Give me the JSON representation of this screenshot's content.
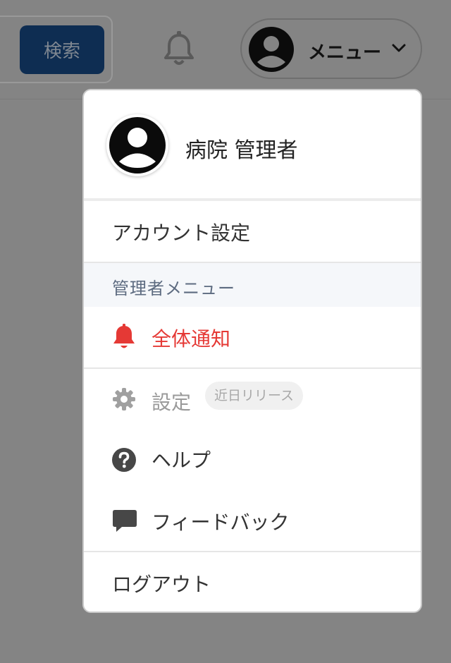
{
  "header": {
    "search_button_label": "検索",
    "menu_label": "メニュー"
  },
  "dropdown": {
    "profile_name": "病院 管理者",
    "account_settings": "アカウント設定",
    "admin_section_title": "管理者メニュー",
    "notify_all": "全体通知",
    "settings_label": "設定",
    "settings_badge": "近日リリース",
    "help_label": "ヘルプ",
    "feedback_label": "フィードバック",
    "logout_label": "ログアウト"
  },
  "colors": {
    "overlay_bg": "#848484",
    "search_button": "#0e2d52",
    "danger": "#e53935",
    "disabled_text": "#9a9a9a",
    "section_bg": "#f5f7fa"
  },
  "icons": [
    "bell-icon",
    "user-avatar-icon",
    "chevron-down-icon",
    "gear-icon",
    "help-circle-icon",
    "comment-icon"
  ]
}
